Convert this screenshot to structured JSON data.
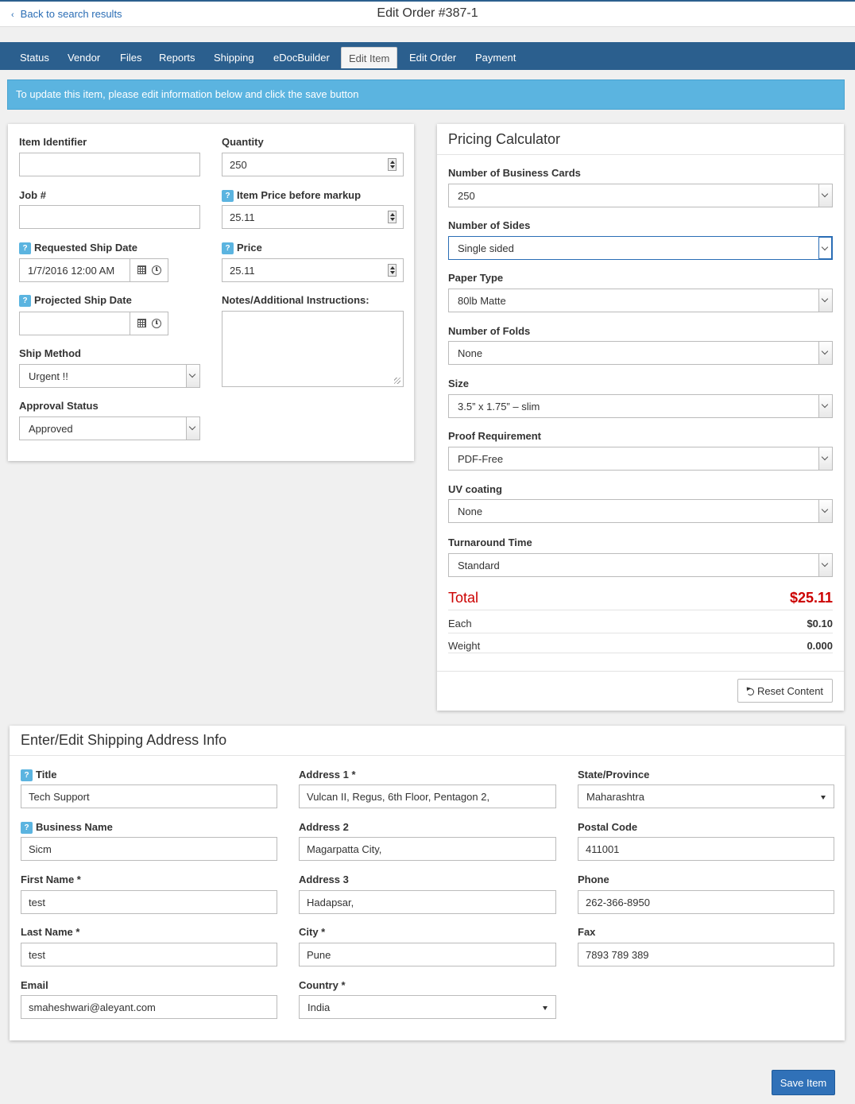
{
  "header": {
    "back_label": "Back to search results",
    "title": "Edit Order #387-1"
  },
  "nav": {
    "tabs": [
      {
        "label": "Status"
      },
      {
        "label": "Vendor"
      },
      {
        "label": "Files"
      },
      {
        "label": "Reports"
      },
      {
        "label": "Shipping"
      },
      {
        "label": "eDocBuilder"
      },
      {
        "label": "Edit Item"
      },
      {
        "label": "Edit Order"
      },
      {
        "label": "Payment"
      }
    ],
    "active": "Edit Item"
  },
  "banner": {
    "text": "To update this item, please edit information below and click the save button"
  },
  "item_form": {
    "item_identifier": {
      "label": "Item Identifier",
      "value": ""
    },
    "job": {
      "label": "Job #",
      "value": ""
    },
    "requested_ship_date": {
      "label": "Requested Ship Date",
      "value": "1/7/2016 12:00 AM"
    },
    "projected_ship_date": {
      "label": "Projected Ship Date",
      "value": ""
    },
    "ship_method": {
      "label": "Ship Method",
      "value": "Urgent !!"
    },
    "approval_status": {
      "label": "Approval Status",
      "value": "Approved"
    },
    "quantity": {
      "label": "Quantity",
      "value": "250"
    },
    "item_price": {
      "label": "Item Price before markup",
      "value": "25.11"
    },
    "price": {
      "label": "Price",
      "value": "25.11"
    },
    "notes": {
      "label": "Notes/Additional Instructions:",
      "value": ""
    },
    "help_glyph": "?"
  },
  "pricing": {
    "title": "Pricing Calculator",
    "fields": [
      {
        "label": "Number of Business Cards",
        "value": "250"
      },
      {
        "label": "Number of Sides",
        "value": "Single sided"
      },
      {
        "label": "Paper Type",
        "value": "80lb Matte"
      },
      {
        "label": "Number of Folds",
        "value": "None"
      },
      {
        "label": "Size",
        "value": "3.5” x 1.75” – slim"
      },
      {
        "label": "Proof Requirement",
        "value": "PDF-Free"
      },
      {
        "label": "UV coating",
        "value": "None"
      },
      {
        "label": "Turnaround Time",
        "value": "Standard"
      }
    ],
    "total_label": "Total",
    "total_value": "$25.11",
    "each_label": "Each",
    "each_value": "$0.10",
    "weight_label": "Weight",
    "weight_value": "0.000",
    "reset_label": "Reset Content",
    "total_color": "#cc0000"
  },
  "shipping": {
    "title": "Enter/Edit Shipping Address Info",
    "title_field": {
      "label": "Title",
      "value": "Tech Support"
    },
    "business_name": {
      "label": "Business Name",
      "value": "Sicm"
    },
    "first_name": {
      "label": "First Name *",
      "value": "test"
    },
    "last_name": {
      "label": "Last Name *",
      "value": "test"
    },
    "email": {
      "label": "Email",
      "value": "smaheshwari@aleyant.com"
    },
    "address1": {
      "label": "Address 1 *",
      "value": "Vulcan II, Regus, 6th Floor, Pentagon 2,"
    },
    "address2": {
      "label": "Address 2",
      "value": "Magarpatta City,"
    },
    "address3": {
      "label": "Address 3",
      "value": "Hadapsar,"
    },
    "city": {
      "label": "City *",
      "value": "Pune"
    },
    "country": {
      "label": "Country *",
      "value": "India"
    },
    "state": {
      "label": "State/Province",
      "value": "Maharashtra"
    },
    "postal": {
      "label": "Postal Code",
      "value": "411001"
    },
    "phone": {
      "label": "Phone",
      "value": "262-366-8950"
    },
    "fax": {
      "label": "Fax",
      "value": "7893 789 389"
    }
  },
  "footer": {
    "save_label": "Save Item"
  },
  "colors": {
    "navbar": "#2b5f8e",
    "banner": "#5bb4e0",
    "primary_button": "#3071b8"
  }
}
